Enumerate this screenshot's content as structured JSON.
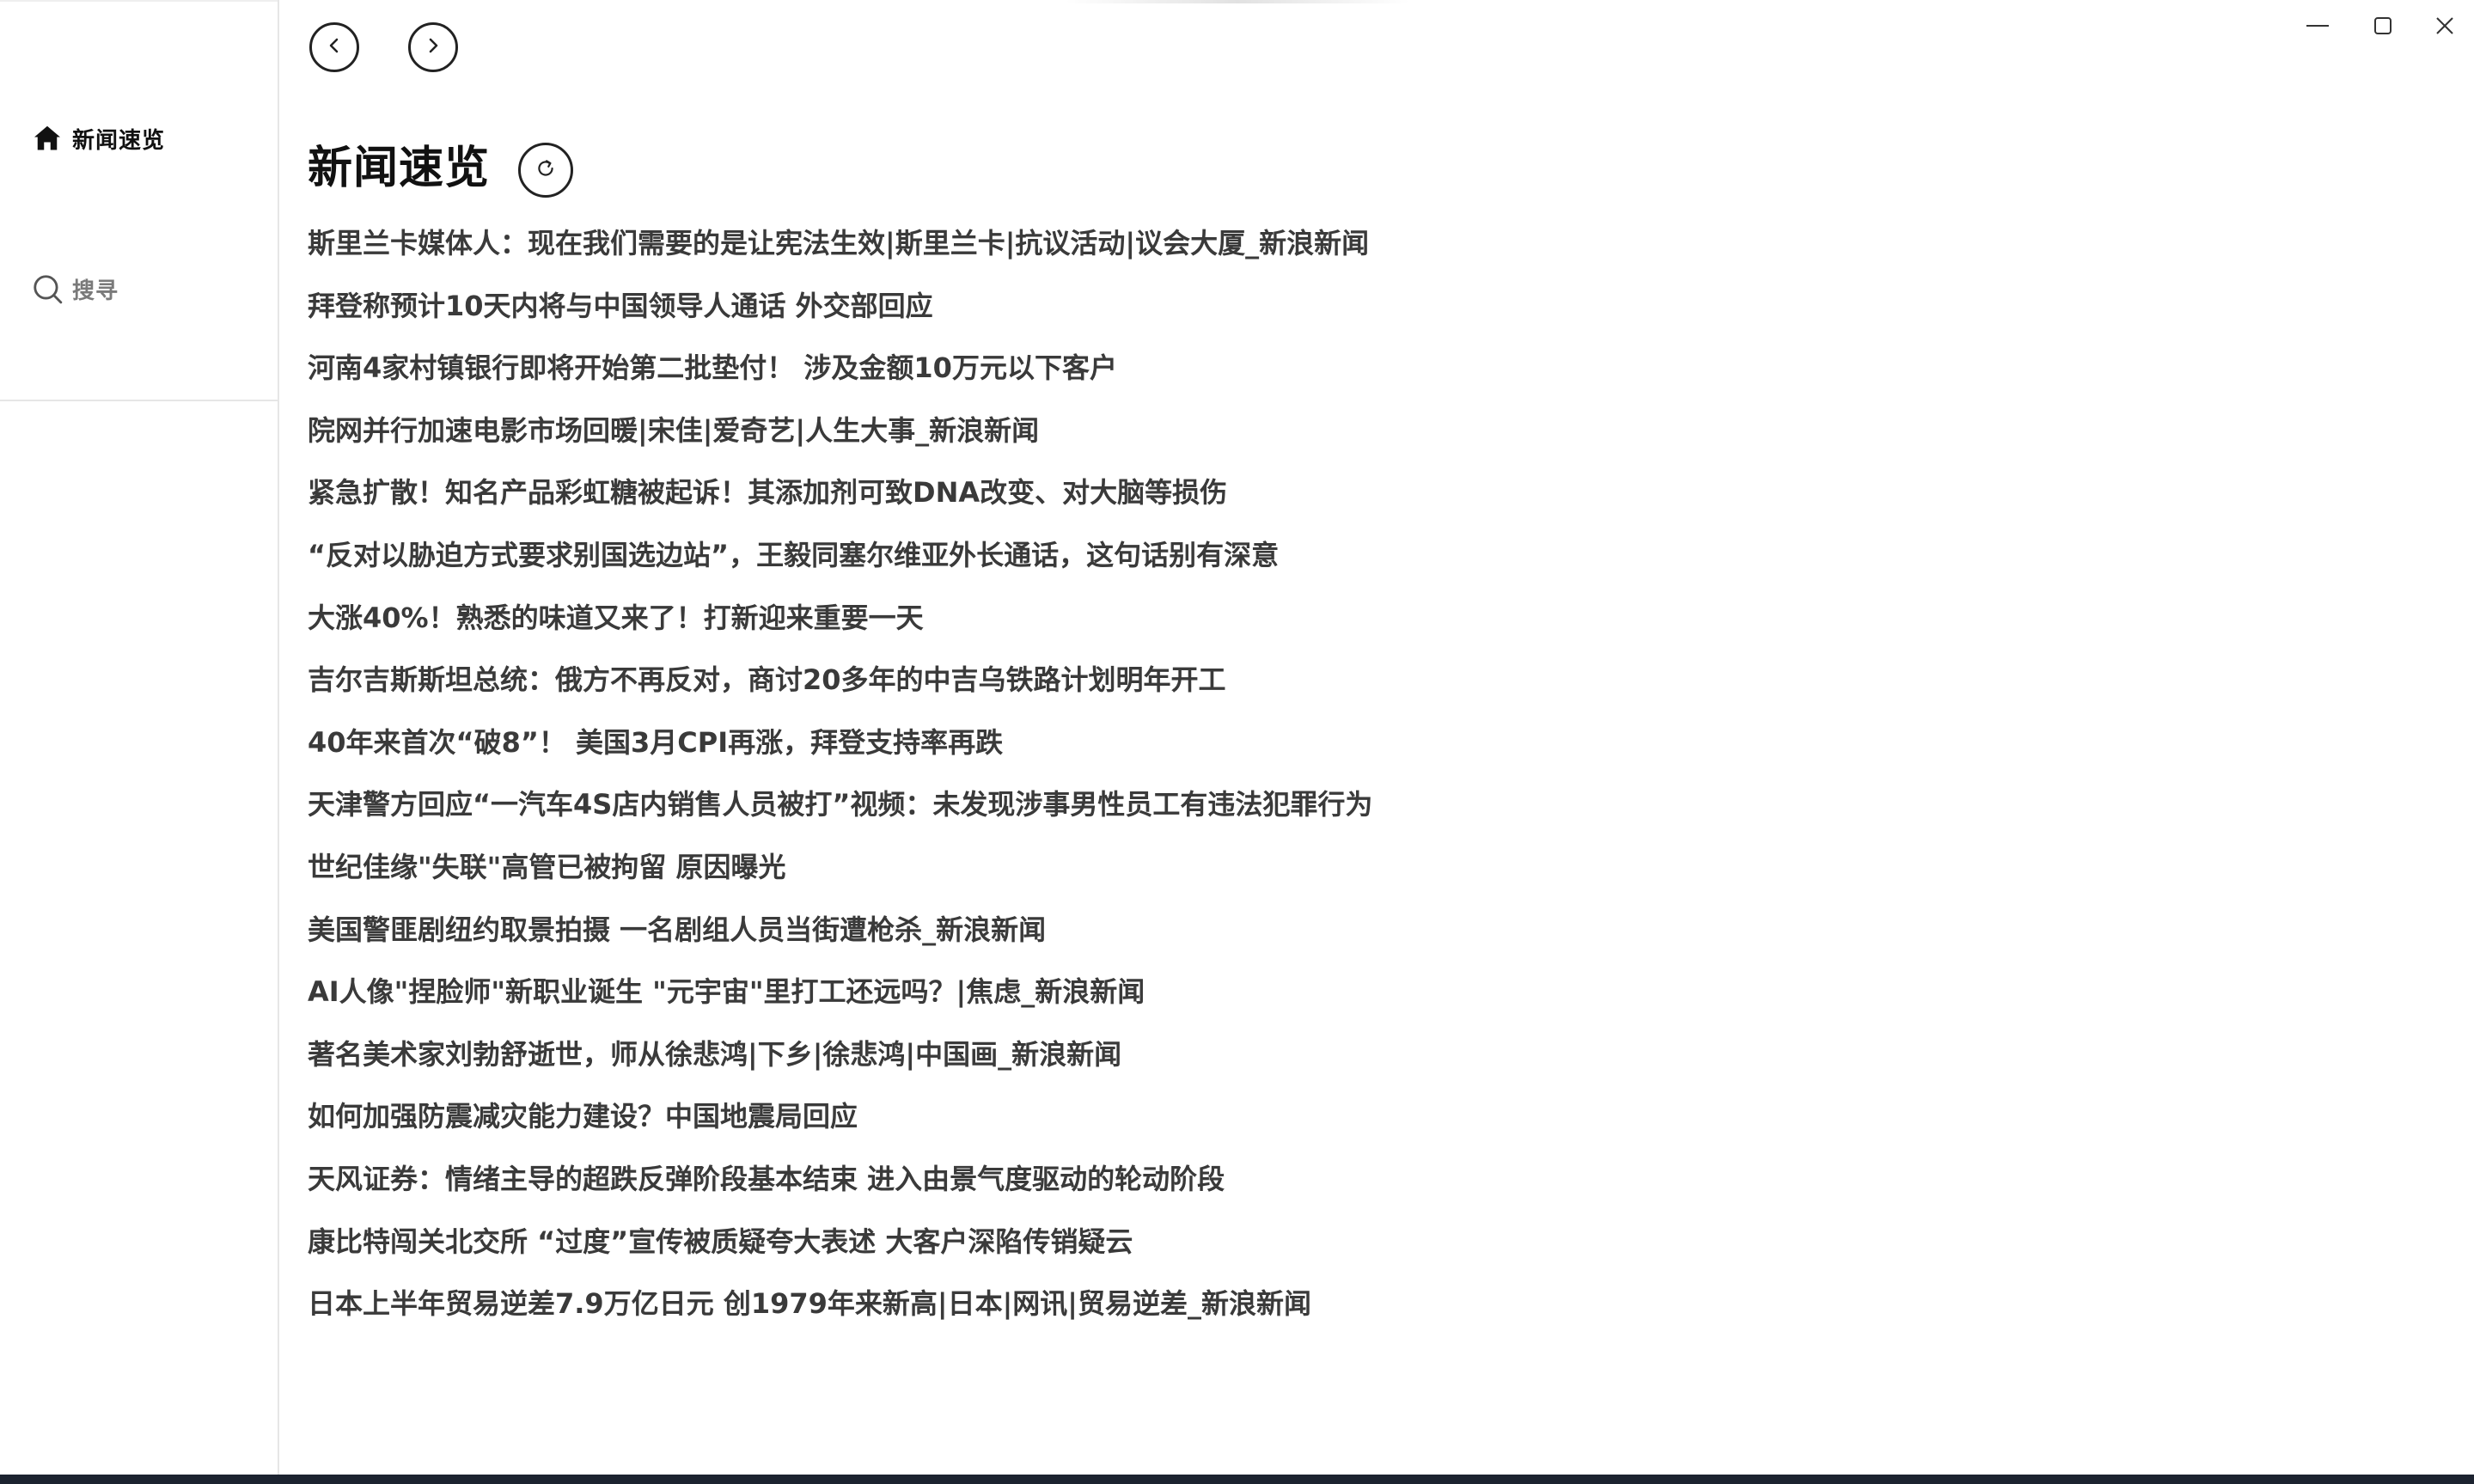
{
  "sidebar": {
    "items": [
      {
        "label": "新闻速览",
        "icon": "home-icon"
      },
      {
        "label": "搜寻",
        "icon": "search-icon"
      }
    ]
  },
  "toolbar": {
    "back_icon": "chevron-left-icon",
    "forward_icon": "chevron-right-icon"
  },
  "window_controls": [
    "minimize-icon",
    "maximize-icon",
    "close-icon"
  ],
  "main": {
    "title": "新闻速览",
    "refresh_icon": "refresh-icon",
    "news": [
      "斯里兰卡媒体人：现在我们需要的是让宪法生效|斯里兰卡|抗议活动|议会大厦_新浪新闻",
      "拜登称预计10天内将与中国领导人通话 外交部回应",
      "河南4家村镇银行即将开始第二批垫付！ 涉及金额10万元以下客户",
      "院网并行加速电影市场回暖|宋佳|爱奇艺|人生大事_新浪新闻",
      "紧急扩散！知名产品彩虹糖被起诉！其添加剂可致DNA改变、对大脑等损伤",
      "“反对以胁迫方式要求别国选边站”，王毅同塞尔维亚外长通话，这句话别有深意",
      "大涨40%！熟悉的味道又来了！打新迎来重要一天",
      "吉尔吉斯斯坦总统：俄方不再反对，商讨20多年的中吉乌铁路计划明年开工",
      "40年来首次“破8”！ 美国3月CPI再涨，拜登支持率再跌",
      "天津警方回应“一汽车4S店内销售人员被打”视频：未发现涉事男性员工有违法犯罪行为",
      "世纪佳缘\"失联\"高管已被拘留 原因曝光",
      "美国警匪剧纽约取景拍摄 一名剧组人员当街遭枪杀_新浪新闻",
      "AI人像\"捏脸师\"新职业诞生 \"元宇宙\"里打工还远吗？|焦虑_新浪新闻",
      "著名美术家刘勃舒逝世，师从徐悲鸿|下乡|徐悲鸿|中国画_新浪新闻",
      "如何加强防震减灾能力建设？中国地震局回应",
      "天风证券：情绪主导的超跌反弹阶段基本结束 进入由景气度驱动的轮动阶段",
      "康比特闯关北交所 “过度”宣传被质疑夸大表述 大客户深陷传销疑云",
      "日本上半年贸易逆差7.9万亿日元 创1979年来新高|日本|网讯|贸易逆差_新浪新闻"
    ]
  },
  "colors": {
    "text_primary": "#111111",
    "text_news": "#3a3a3a",
    "text_muted": "#7a7a7a",
    "taskbar": "#1c2330"
  }
}
